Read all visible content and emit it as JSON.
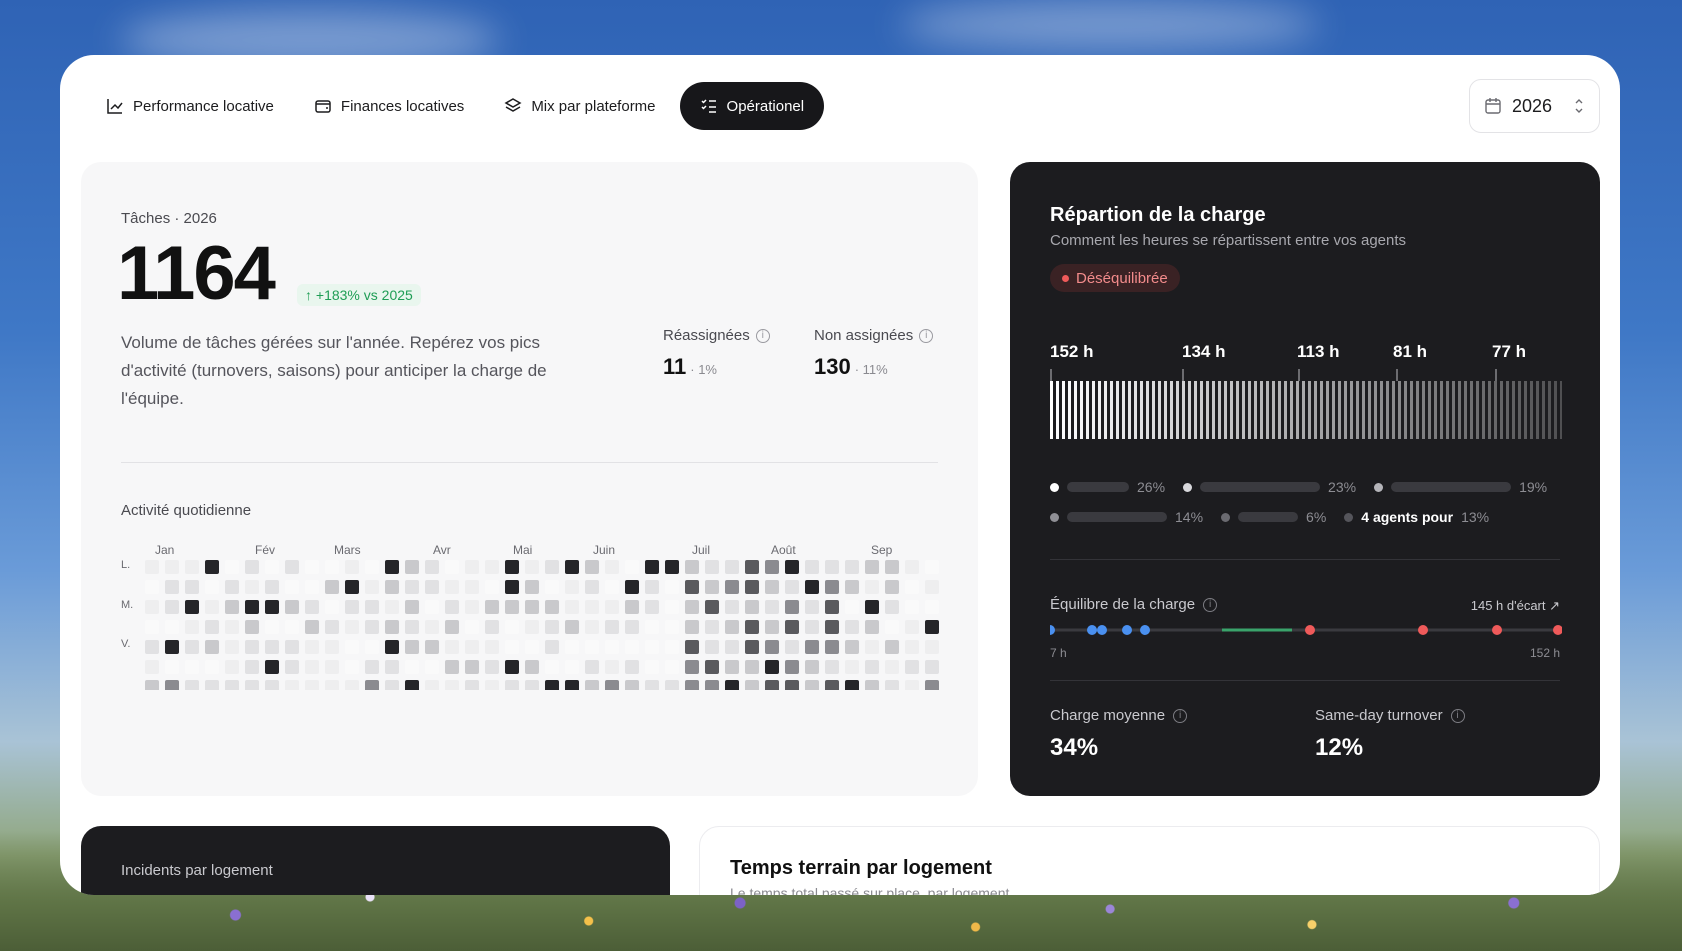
{
  "tabs": [
    {
      "label": "Performance locative",
      "icon": "line-chart-icon",
      "active": false
    },
    {
      "label": "Finances locatives",
      "icon": "wallet-icon",
      "active": false
    },
    {
      "label": "Mix par plateforme",
      "icon": "layers-icon",
      "active": false
    },
    {
      "label": "Opérationel",
      "icon": "list-check-icon",
      "active": true
    }
  ],
  "year_select": {
    "value": "2026"
  },
  "tasks": {
    "kicker": "Tâches · 2026",
    "total": "1164",
    "delta": "↑ +183% vs 2025",
    "description": "Volume de tâches gérées sur l'année. Repérez vos pics d'activité (turnovers, saisons) pour anticiper la charge de l'équipe.",
    "reassigned": {
      "label": "Réassignées",
      "value": "11",
      "pct": "· 1%"
    },
    "unassigned": {
      "label": "Non assignées",
      "value": "130",
      "pct": "· 11%"
    }
  },
  "activity": {
    "title": "Activité quotidienne",
    "months": [
      "Jan",
      "Fév",
      "Mars",
      "Avr",
      "Mai",
      "Juin",
      "Juil",
      "Août",
      "Sep"
    ],
    "day_labels": [
      "L.",
      "M.",
      "V."
    ]
  },
  "workload": {
    "title": "Répartion de la charge",
    "subtitle": "Comment les heures se répartissent entre vos agents",
    "status": "Déséquilibrée",
    "hours": [
      "152 h",
      "134 h",
      "113 h",
      "81 h",
      "77 h"
    ],
    "legend": [
      "26%",
      "23%",
      "19%",
      "14%",
      "6%",
      "13%"
    ],
    "legend_named": "4 agents pour",
    "balance_title": "Équilibre de la charge",
    "balance_gap": "145 h d'écart ↗",
    "range_min": "7 h",
    "range_max": "152 h",
    "avg_label": "Charge moyenne",
    "avg_value": "34%",
    "sameday_label": "Same-day turnover",
    "sameday_value": "12%"
  },
  "incidents": {
    "title": "Incidents par logement"
  },
  "field_time": {
    "title": "Temps terrain par logement",
    "subtitle": "Le temps total passé sur place, par logement"
  },
  "colors": {
    "accent_dark": "#17171a",
    "positive": "#1f9d55",
    "alert": "#ef5a5a",
    "balance_blue": "#4a90f0",
    "balance_green": "#3aa36b"
  }
}
